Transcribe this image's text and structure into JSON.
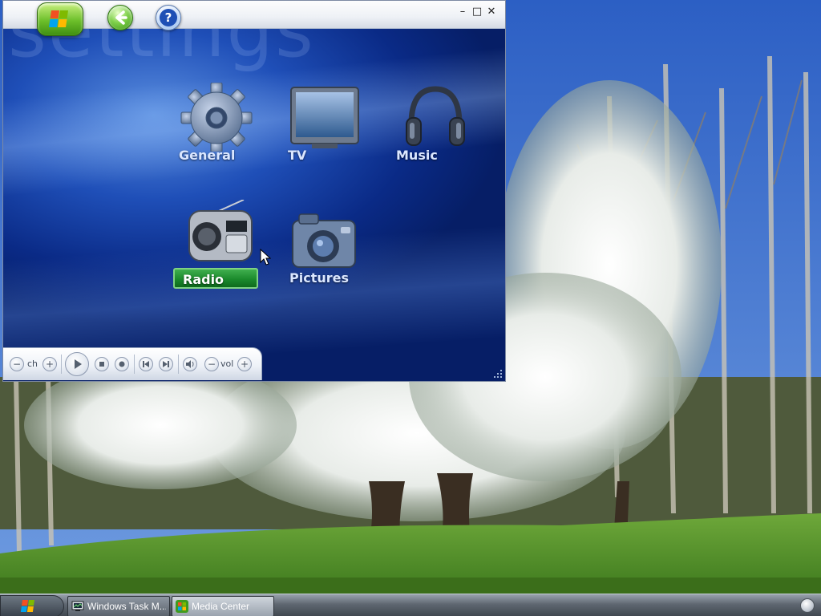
{
  "window": {
    "title_watermark": "settings",
    "controls": {
      "minimize": "–",
      "maximize": "□",
      "close": "✕"
    },
    "toolbar": {
      "start_icon": "windows-logo-icon",
      "back_icon": "back-arrow-icon",
      "help_label": "?"
    }
  },
  "menu": {
    "items": [
      {
        "label": "General",
        "icon": "gear-icon"
      },
      {
        "label": "TV",
        "icon": "tv-icon"
      },
      {
        "label": "Music",
        "icon": "headphones-icon"
      },
      {
        "label": "Radio",
        "icon": "radio-icon",
        "selected": true
      },
      {
        "label": "Pictures",
        "icon": "camera-icon"
      }
    ]
  },
  "transport": {
    "ch_label": "ch",
    "vol_label": "vol",
    "minus": "−",
    "plus": "+"
  },
  "taskbar": {
    "buttons": [
      {
        "label": "Windows Task M...",
        "icon": "task-manager-icon"
      },
      {
        "label": "Media Center",
        "icon": "media-center-icon",
        "active": true
      }
    ]
  },
  "colors": {
    "window_blue": "#1f4fb8",
    "selected_green": "#1b8a2c",
    "label_text": "#dbe7ff"
  }
}
